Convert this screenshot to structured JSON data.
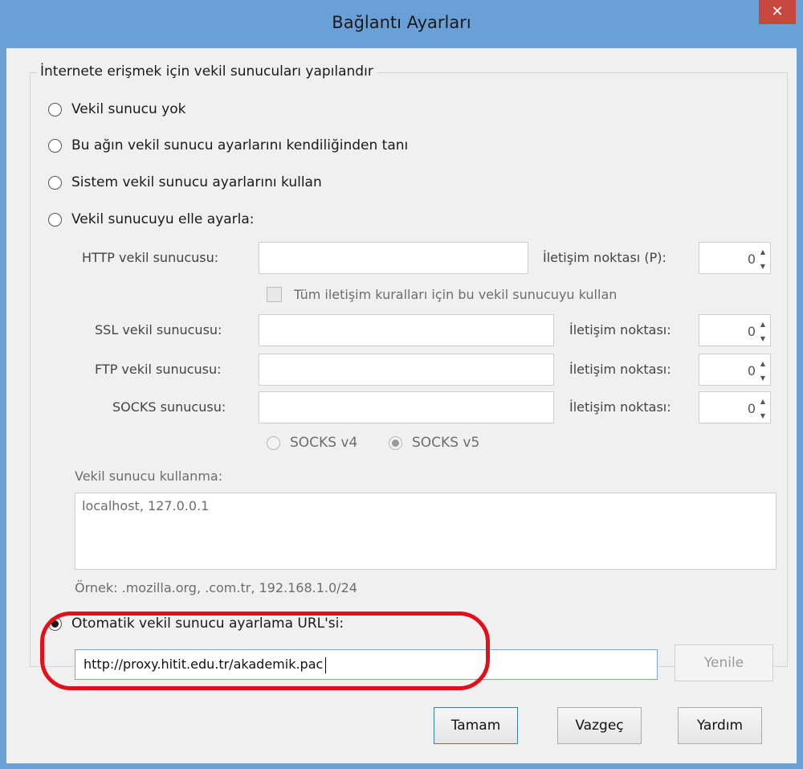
{
  "window": {
    "title": "Bağlantı Ayarları",
    "close_label": "✕"
  },
  "group_legend": "İnternete erişmek için vekil sunucuları yapılandır",
  "options": {
    "no_proxy": "Vekil sunucu yok",
    "auto_detect": "Bu ağın vekil sunucu ayarlarını kendiliğinden tanı",
    "system_proxy": "Sistem vekil sunucu ayarlarını kullan",
    "manual_proxy": "Vekil sunucuyu elle ayarla:",
    "auto_config_url": "Otomatik vekil sunucu ayarlama URL'si:"
  },
  "manual": {
    "http_label": "HTTP vekil sunucusu:",
    "http_port_label": "İletişim noktası (P):",
    "http_port_value": "0",
    "use_for_all_label": "Tüm iletişim kuralları için bu vekil sunucuyu kullan",
    "ssl_label": "SSL vekil sunucusu:",
    "ssl_port_label": "İletişim noktası:",
    "ssl_port_value": "0",
    "ftp_label": "FTP vekil sunucusu:",
    "ftp_port_label": "İletişim noktası:",
    "ftp_port_value": "0",
    "socks_label": "SOCKS sunucusu:",
    "socks_port_label": "İletişim noktası:",
    "socks_port_value": "0",
    "socks_v4": "SOCKS v4",
    "socks_v5": "SOCKS v5"
  },
  "no_proxy_for": {
    "label": "Vekil sunucu kullanma:",
    "value": "localhost, 127.0.0.1",
    "example": "Örnek: .mozilla.org, .com.tr, 192.168.1.0/24"
  },
  "auto_url": {
    "value": "http://proxy.hitit.edu.tr/akademik.pac",
    "reload_label": "Yenile"
  },
  "buttons": {
    "ok": "Tamam",
    "cancel": "Vazgeç",
    "help": "Yardım"
  },
  "colors": {
    "titlebar": "#6aa0d8",
    "close": "#c7463d",
    "highlight": "#e3101a"
  }
}
